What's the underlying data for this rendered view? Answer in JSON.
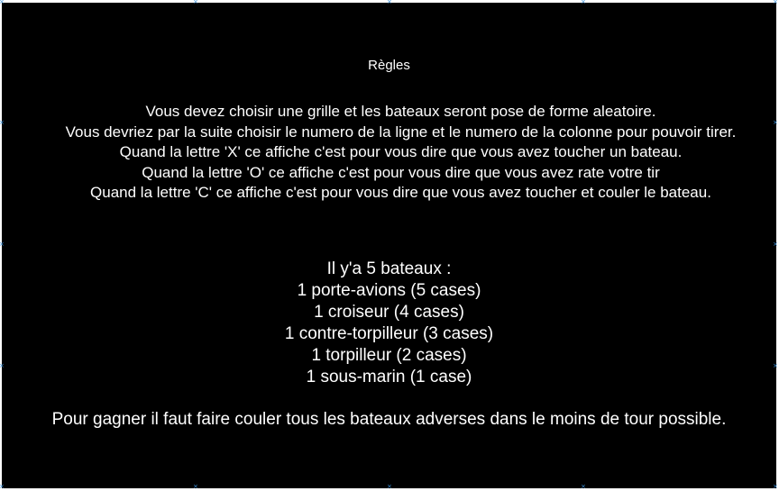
{
  "rules_panel": {
    "title": "Règles",
    "lines": [
      "Vous devez choisir une grille et les bateaux seront pose de forme aleatoire.",
      "Vous devriez par la suite choisir le numero de la ligne et le numero de la colonne pour pouvoir tirer.",
      "Quand la lettre 'X' ce affiche c'est pour vous dire que vous avez toucher un bateau.",
      "Quand la lettre 'O' ce affiche c'est pour vous dire que vous avez rate votre tir",
      "Quand la lettre 'C' ce affiche c'est pour vous dire que vous avez toucher et couler le bateau."
    ],
    "boats_heading": "Il y'a 5 bateaux :",
    "boats": [
      "1 porte-avions (5 cases)",
      "1 croiseur (4 cases)",
      "1 contre-torpilleur (3 cases)",
      "1 torpilleur (2 cases)",
      "1 sous-marin (1 case)"
    ],
    "goal": "Pour gagner il faut faire couler tous les bateaux adverses dans le moins de tour possible."
  },
  "colors": {
    "background": "#000000",
    "text": "#ffffff",
    "handle": "#3a8fd8"
  },
  "icons": {
    "resize_handle": "resize-handle-icon"
  }
}
